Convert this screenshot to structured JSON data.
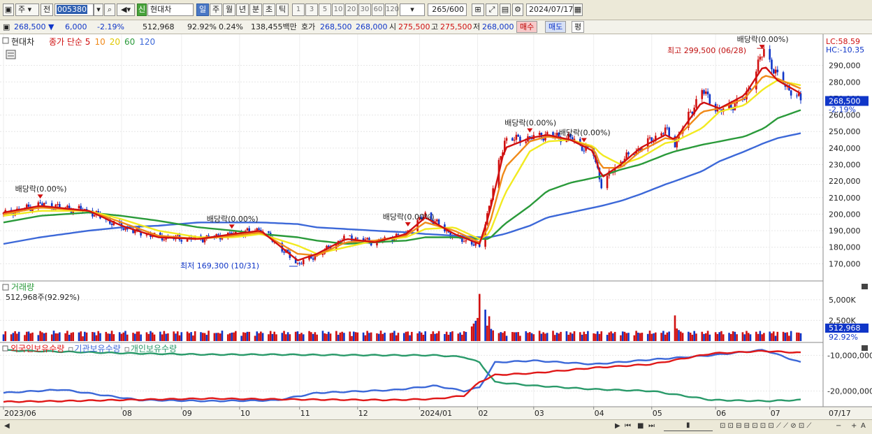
{
  "toolbar": {
    "market": "주",
    "prev_label": "전",
    "stock_code": "005380",
    "stock_name": "현대차",
    "new_badge": "신",
    "periods": [
      "일",
      "주",
      "월",
      "년",
      "분",
      "초",
      "틱"
    ],
    "active_period": "일",
    "intervals": [
      "1",
      "3",
      "5",
      "10",
      "20",
      "30",
      "60",
      "120"
    ],
    "count": "265",
    "count_total": "/600",
    "date": "2024/07/17"
  },
  "quote": {
    "price": "268,500 ▼",
    "change": "6,000",
    "change_pct": "-2.19%",
    "volume": "512,968",
    "volume_ratio": "92.92%",
    "turnover_rate": "0.24%",
    "amount": "138,455백만",
    "hoga_label": "호가",
    "ask": "268,500",
    "bid": "268,000",
    "open_label": "시",
    "open": "275,500",
    "high_label": "고",
    "high": "275,500",
    "low_label": "저",
    "low": "268,000",
    "buy_button": "매수",
    "sell_button": "매도",
    "eval_button": "평"
  },
  "colors": {
    "up": "#d01010",
    "down": "#1036c8",
    "ma5": "#d01010",
    "ma10": "#f08a1a",
    "ma20": "#f2ea20",
    "ma60": "#2a9a3a",
    "ma120": "#3c68d8",
    "foreign": "#e01818",
    "institution": "#3c68d8",
    "individual": "#2a9a6a"
  },
  "chart_data": {
    "type": "candlestick",
    "price_pane": {
      "title": "현대차",
      "legend": [
        {
          "name": "종가 단순 5",
          "color": "#d01010"
        },
        {
          "name": "10",
          "color": "#f08a1a"
        },
        {
          "name": "20",
          "color": "#e0c800"
        },
        {
          "name": "60",
          "color": "#2a9a3a"
        },
        {
          "name": "120",
          "color": "#3c68d8"
        }
      ],
      "ylim": [
        160000,
        300000
      ],
      "yticks": [
        "170,000",
        "180,000",
        "190,000",
        "200,000",
        "210,000",
        "220,000",
        "230,000",
        "240,000",
        "250,000",
        "260,000",
        "270,000",
        "280,000",
        "290,000"
      ],
      "current_price_label": "268,500",
      "current_change_label": "-2.19%",
      "lc_label": "LC:58.59",
      "hc_label": "HC:-10.35",
      "high_annotation": "최고 299,500 (06/28)",
      "low_annotation": "최저 169,300 (10/31)",
      "dividend_label": "배당락(0.00%)",
      "anchors_date": [
        "2023-06-01",
        "2023-06-20",
        "2023-07-15",
        "2023-08-01",
        "2023-08-20",
        "2023-09-10",
        "2023-09-28",
        "2023-10-12",
        "2023-10-31",
        "2023-11-10",
        "2023-11-25",
        "2023-12-10",
        "2023-12-26",
        "2024-01-05",
        "2024-01-20",
        "2024-02-02",
        "2024-02-07",
        "2024-02-15",
        "2024-02-28",
        "2024-03-08",
        "2024-03-20",
        "2024-04-01",
        "2024-04-05",
        "2024-04-15",
        "2024-04-25",
        "2024-05-08",
        "2024-05-13",
        "2024-05-27",
        "2024-06-05",
        "2024-06-18",
        "2024-06-28",
        "2024-07-05",
        "2024-07-17"
      ],
      "anchors_close": [
        200000,
        206000,
        202000,
        192000,
        186000,
        185000,
        188000,
        191000,
        170000,
        175000,
        186000,
        183000,
        188000,
        200000,
        186000,
        181000,
        205000,
        245000,
        246000,
        248000,
        246000,
        236000,
        218000,
        232000,
        240000,
        251000,
        243000,
        275000,
        262000,
        270000,
        299500,
        283000,
        268500
      ],
      "ma5_close": [
        201000,
        205000,
        202000,
        193000,
        186000,
        185000,
        188000,
        190000,
        172000,
        176000,
        185000,
        183000,
        188000,
        198000,
        188000,
        182000,
        200000,
        240000,
        246000,
        248000,
        245000,
        238000,
        222000,
        230000,
        240000,
        248000,
        245000,
        268000,
        264000,
        272000,
        290000,
        281000,
        273000
      ],
      "ma10_close": [
        200000,
        204000,
        202000,
        195000,
        187000,
        185000,
        187000,
        189000,
        176000,
        175000,
        183000,
        184000,
        187000,
        195000,
        190000,
        183000,
        193000,
        228000,
        244000,
        247000,
        245000,
        240000,
        228000,
        228000,
        238000,
        246000,
        245000,
        262000,
        264000,
        270000,
        284000,
        282000,
        276000
      ],
      "ma20_close": [
        199000,
        202000,
        202000,
        197000,
        190000,
        186000,
        186000,
        188000,
        181000,
        176000,
        180000,
        184000,
        186000,
        191000,
        192000,
        185000,
        188000,
        212000,
        238000,
        244000,
        245000,
        241000,
        236000,
        230000,
        234000,
        243000,
        244000,
        252000,
        262000,
        266000,
        276000,
        281000,
        278000
      ],
      "ma60_close": [
        195000,
        199000,
        201000,
        199000,
        196000,
        192000,
        190000,
        188000,
        186000,
        184000,
        182000,
        183000,
        184000,
        186000,
        186000,
        185000,
        185000,
        194000,
        205000,
        214000,
        219000,
        222000,
        223000,
        227000,
        230000,
        236000,
        238000,
        242000,
        244000,
        247000,
        252000,
        258000,
        263000
      ],
      "ma120_close": [
        182000,
        186000,
        190000,
        192000,
        193000,
        195000,
        195000,
        195000,
        194000,
        192000,
        191000,
        190000,
        189000,
        188000,
        187000,
        186000,
        186000,
        188000,
        193000,
        198000,
        201000,
        204000,
        205000,
        208000,
        212000,
        218000,
        220000,
        226000,
        232000,
        238000,
        243000,
        246000,
        249000
      ],
      "dividend_markers": [
        "2023-06-20",
        "2023-09-27",
        "2023-12-27",
        "2024-02-28",
        "2024-03-27",
        "2024-06-27"
      ]
    },
    "volume_pane": {
      "title": "거래량",
      "current_label": "512,968주(92.92%)",
      "ylim": [
        0,
        6000000
      ],
      "yticks": [
        "2,500K",
        "5,000K"
      ],
      "value_box": "512,968",
      "pct_box": "92.92%",
      "spikes": [
        {
          "date": "2024-02-02",
          "value": 5700000
        },
        {
          "date": "2024-02-05",
          "value": 3800000
        },
        {
          "date": "2024-02-07",
          "value": 3000000
        },
        {
          "date": "2024-05-13",
          "value": 3100000
        }
      ],
      "base_volume": 900000
    },
    "holdings_pane": {
      "legend": [
        {
          "name": "외국인보유수량",
          "color": "#e01818"
        },
        {
          "name": "기관보유수량",
          "color": "#3c68d8"
        },
        {
          "name": "개인보유수량",
          "color": "#2a9a6a"
        }
      ],
      "yticks": [
        "-20,000,000",
        "-10,000,000"
      ],
      "ylim": [
        -24000000,
        -7000000
      ],
      "anchors_date": [
        "2023-06-01",
        "2023-07-01",
        "2023-08-10",
        "2023-09-15",
        "2023-10-20",
        "2023-11-10",
        "2023-12-20",
        "2024-01-10",
        "2024-01-25",
        "2024-02-02",
        "2024-02-10",
        "2024-03-01",
        "2024-04-01",
        "2024-05-01",
        "2024-06-01",
        "2024-06-28",
        "2024-07-17"
      ],
      "foreign": [
        -23000000,
        -22800000,
        -22400000,
        -22100000,
        -22300000,
        -22400000,
        -22500000,
        -22200000,
        -21300000,
        -17500000,
        -15500000,
        -15000000,
        -13500000,
        -12500000,
        -9500000,
        -8800000,
        -9300000
      ],
      "institution": [
        -20500000,
        -19600000,
        -22500000,
        -22800000,
        -22600000,
        -20500000,
        -19700000,
        -18500000,
        -20000000,
        -19000000,
        -12000000,
        -11500000,
        -12500000,
        -11200000,
        -10000000,
        -8500000,
        -12000000
      ],
      "individual": [
        -8600000,
        -9000000,
        -9500000,
        -9800000,
        -9800000,
        -9900000,
        -10000000,
        -10000000,
        -10500000,
        -12000000,
        -17500000,
        -18500000,
        -19500000,
        -20000000,
        -22500000,
        -22800000,
        -22500000
      ]
    },
    "x_axis": {
      "labels": [
        {
          "date": "2023-06-01",
          "text": "2023/06"
        },
        {
          "date": "2023-08-01",
          "text": "08"
        },
        {
          "date": "2023-09-01",
          "text": "09"
        },
        {
          "date": "2023-10-01",
          "text": "10"
        },
        {
          "date": "2023-11-01",
          "text": "11"
        },
        {
          "date": "2023-12-01",
          "text": "12"
        },
        {
          "date": "2024-01-02",
          "text": "2024/01"
        },
        {
          "date": "2024-02-01",
          "text": "02"
        },
        {
          "date": "2024-03-01",
          "text": "03"
        },
        {
          "date": "2024-04-01",
          "text": "04"
        },
        {
          "date": "2024-05-01",
          "text": "05"
        },
        {
          "date": "2024-06-03",
          "text": "06"
        },
        {
          "date": "2024-07-01",
          "text": "07"
        }
      ],
      "last_date_label": "07/17"
    }
  }
}
